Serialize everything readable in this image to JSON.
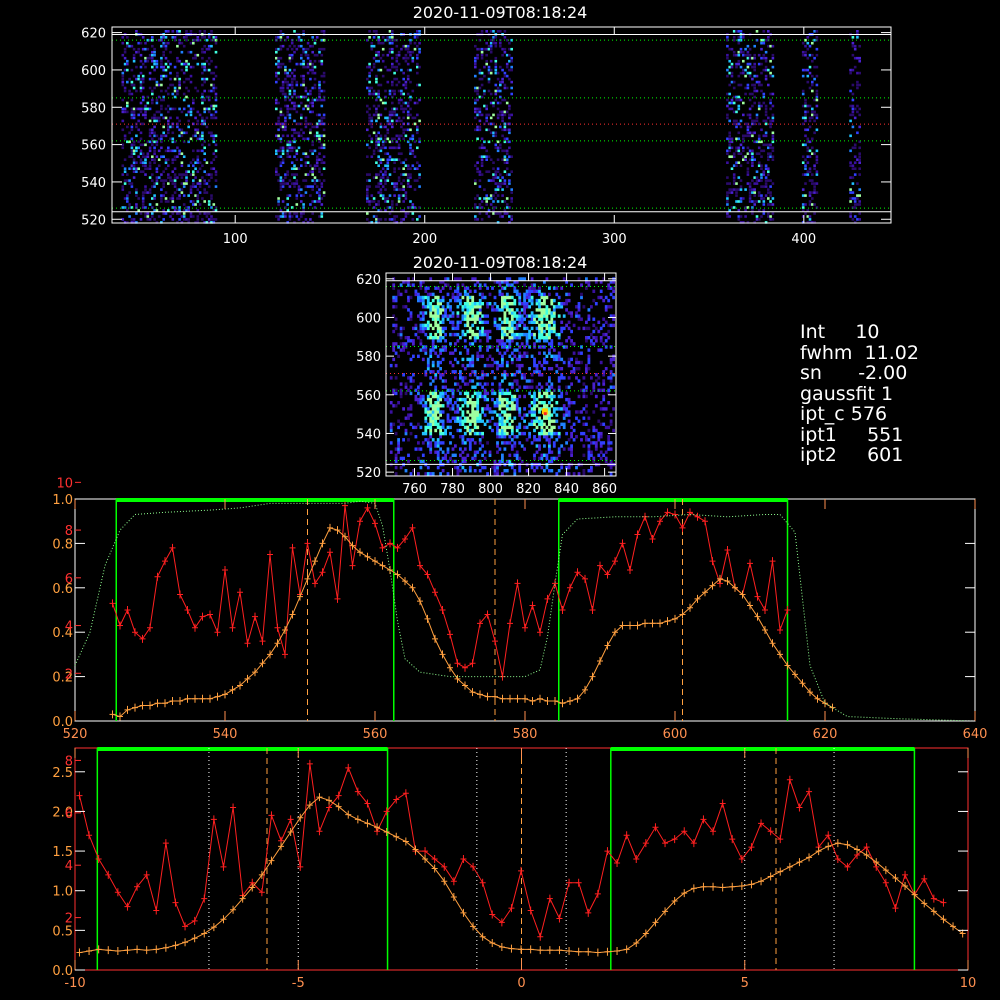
{
  "panels": [
    {
      "id": "top",
      "title": "2020-11-09T08:18:24",
      "xticks": [
        "100",
        "200",
        "300",
        "400"
      ],
      "yticks": [
        "520",
        "540",
        "560",
        "580",
        "600",
        "620"
      ],
      "xrange": [
        35,
        446
      ],
      "yrange": [
        518,
        623
      ],
      "stripes": [
        [
          40,
          90
        ],
        [
          121,
          147
        ],
        [
          169,
          197
        ],
        [
          226,
          246
        ],
        [
          359,
          384
        ],
        [
          399,
          407
        ],
        [
          424,
          429
        ]
      ],
      "hlines": [
        {
          "y": 619,
          "style": "solid",
          "color": "#ffffff"
        },
        {
          "y": 616,
          "style": "dot",
          "color": "#00ff00"
        },
        {
          "y": 585,
          "style": "dot",
          "color": "#00ff00"
        },
        {
          "y": 571,
          "style": "dot",
          "color": "#ff3030"
        },
        {
          "y": 562,
          "style": "dot",
          "color": "#00ff00"
        },
        {
          "y": 526,
          "style": "dot",
          "color": "#00ff00"
        },
        {
          "y": 524,
          "style": "solid",
          "color": "#ffffff"
        }
      ]
    },
    {
      "id": "mid",
      "title": "2020-11-09T08:18:24",
      "xticks": [
        "760",
        "780",
        "800",
        "820",
        "840",
        "860"
      ],
      "yticks": [
        "520",
        "540",
        "560",
        "580",
        "600",
        "620"
      ],
      "xrange": [
        745,
        866
      ],
      "yrange": [
        518,
        623
      ],
      "hlines": [
        {
          "y": 619,
          "style": "solid",
          "color": "#ffffff"
        },
        {
          "y": 616,
          "style": "dot",
          "color": "#00ff00"
        },
        {
          "y": 585,
          "style": "dot",
          "color": "#00ff00"
        },
        {
          "y": 571,
          "style": "dot",
          "color": "#ff3030"
        },
        {
          "y": 562,
          "style": "dot",
          "color": "#00ff00"
        },
        {
          "y": 526,
          "style": "dot",
          "color": "#00ff00"
        },
        {
          "y": 524,
          "style": "solid",
          "color": "#ffffff"
        }
      ]
    }
  ],
  "params": [
    {
      "key": "Int",
      "value": "10"
    },
    {
      "key": "fwhm",
      "value": "11.02"
    },
    {
      "key": "sn",
      "value": "-2.00"
    },
    {
      "key": "gaussfit",
      "value": "1"
    },
    {
      "key": "ipt_c",
      "value": "576"
    },
    {
      "key": "ipt1",
      "value": "551"
    },
    {
      "key": "ipt2",
      "value": "601"
    }
  ],
  "chart_data": [
    {
      "type": "line",
      "xlim": [
        520,
        640
      ],
      "xticks": [
        "520",
        "540",
        "560",
        "580",
        "600",
        "620",
        "640"
      ],
      "yticks_left_white": [
        "0.0",
        "0.2",
        "0.4",
        "0.6",
        "0.8",
        "1.0"
      ],
      "yticks_left_red": [
        "2",
        "4",
        "6",
        "8",
        "10"
      ],
      "green_boxes": [
        [
          525.5,
          562.5
        ],
        [
          584.5,
          615
        ]
      ],
      "vlines": [
        551,
        576,
        601
      ],
      "series": [
        {
          "color": "#ff2020",
          "marker": "+",
          "x_start": 525,
          "x_step": 1,
          "values": [
            0.53,
            0.43,
            0.5,
            0.4,
            0.37,
            0.42,
            0.65,
            0.72,
            0.78,
            0.57,
            0.5,
            0.42,
            0.47,
            0.48,
            0.4,
            0.68,
            0.42,
            0.58,
            0.35,
            0.47,
            0.36,
            0.75,
            0.42,
            0.3,
            0.78,
            0.57,
            0.8,
            0.62,
            0.67,
            0.76,
            0.55,
            0.97,
            0.7,
            0.9,
            0.96,
            0.89,
            0.78,
            0.8,
            0.78,
            0.82,
            0.87,
            0.7,
            0.66,
            0.58,
            0.5,
            0.39,
            0.26,
            0.24,
            0.26,
            0.44,
            0.48,
            0.36,
            0.2,
            0.44,
            0.62,
            0.42,
            0.52,
            0.4,
            0.55,
            0.62,
            0.5,
            0.6,
            0.67,
            0.64,
            0.5,
            0.7,
            0.66,
            0.72,
            0.8,
            0.68,
            0.84,
            0.92,
            0.82,
            0.9,
            0.94,
            0.93,
            0.87,
            0.94,
            0.92,
            0.9,
            0.72,
            0.62,
            0.77,
            0.6,
            0.57,
            0.71,
            0.56,
            0.5,
            0.72,
            0.41,
            0.5
          ]
        },
        {
          "color": "#ffa040",
          "marker": "+",
          "x_start": 525,
          "x_step": 1,
          "values": [
            0.03,
            0.02,
            0.05,
            0.06,
            0.07,
            0.07,
            0.08,
            0.08,
            0.09,
            0.09,
            0.1,
            0.1,
            0.1,
            0.1,
            0.11,
            0.12,
            0.14,
            0.16,
            0.19,
            0.22,
            0.26,
            0.3,
            0.35,
            0.41,
            0.48,
            0.56,
            0.64,
            0.72,
            0.8,
            0.87,
            0.86,
            0.83,
            0.79,
            0.76,
            0.74,
            0.72,
            0.7,
            0.68,
            0.66,
            0.63,
            0.6,
            0.54,
            0.46,
            0.37,
            0.3,
            0.24,
            0.19,
            0.16,
            0.13,
            0.12,
            0.11,
            0.11,
            0.1,
            0.1,
            0.1,
            0.1,
            0.09,
            0.1,
            0.09,
            0.09,
            0.08,
            0.09,
            0.1,
            0.14,
            0.2,
            0.27,
            0.34,
            0.4,
            0.43,
            0.43,
            0.43,
            0.44,
            0.44,
            0.44,
            0.45,
            0.46,
            0.48,
            0.51,
            0.55,
            0.58,
            0.61,
            0.64,
            0.63,
            0.6,
            0.57,
            0.52,
            0.47,
            0.41,
            0.35,
            0.3,
            0.25,
            0.21,
            0.17,
            0.13,
            0.1,
            0.08,
            0.06
          ]
        },
        {
          "color": "#90ff90",
          "style": "dot",
          "points": [
            [
              520,
              0.25
            ],
            [
              522,
              0.4
            ],
            [
              524,
              0.7
            ],
            [
              526,
              0.86
            ],
            [
              528,
              0.93
            ],
            [
              532,
              0.94
            ],
            [
              538,
              0.95
            ],
            [
              542,
              0.96
            ],
            [
              546,
              0.98
            ],
            [
              552,
              0.98
            ],
            [
              556,
              0.98
            ],
            [
              558,
              0.99
            ],
            [
              560,
              0.98
            ],
            [
              561,
              0.88
            ],
            [
              562,
              0.68
            ],
            [
              563,
              0.45
            ],
            [
              564,
              0.28
            ],
            [
              566,
              0.22
            ],
            [
              570,
              0.2
            ],
            [
              575,
              0.2
            ],
            [
              580,
              0.2
            ],
            [
              582,
              0.23
            ],
            [
              583,
              0.38
            ],
            [
              584,
              0.62
            ],
            [
              585,
              0.84
            ],
            [
              587,
              0.91
            ],
            [
              592,
              0.92
            ],
            [
              597,
              0.92
            ],
            [
              602,
              0.93
            ],
            [
              607,
              0.92
            ],
            [
              612,
              0.93
            ],
            [
              614,
              0.93
            ],
            [
              616,
              0.85
            ],
            [
              617,
              0.55
            ],
            [
              618,
              0.25
            ],
            [
              620,
              0.08
            ],
            [
              623,
              0.02
            ],
            [
              630,
              0.01
            ],
            [
              640,
              0.0
            ]
          ]
        }
      ]
    },
    {
      "type": "line",
      "xlim": [
        -10,
        10
      ],
      "xticks": [
        "-10",
        "-5",
        "0",
        "5",
        "10"
      ],
      "yticks_left_white": [
        "0.0",
        "0.5",
        "1.0",
        "1.5",
        "2.0",
        "2.5"
      ],
      "yticks_left_red": [
        "2",
        "4",
        "6",
        "8"
      ],
      "green_boxes": [
        [
          -9.5,
          -3
        ],
        [
          2,
          8.8
        ]
      ],
      "vlines": [
        -5.7,
        0,
        5.7
      ],
      "dotted_vlines": [
        -7,
        -5,
        -1,
        1,
        5,
        7
      ],
      "series": [
        {
          "color": "#ff2020",
          "marker": "+",
          "x_start": -9.9,
          "x_step": 0.215,
          "values": [
            2.2,
            1.7,
            1.4,
            1.2,
            0.98,
            0.8,
            1.05,
            1.2,
            0.75,
            1.6,
            0.85,
            0.55,
            0.62,
            0.9,
            1.9,
            1.3,
            2.05,
            0.94,
            1.1,
            0.98,
            1.95,
            1.63,
            1.9,
            1.3,
            2.6,
            1.75,
            2.05,
            2.2,
            2.55,
            2.25,
            2.1,
            1.75,
            2.0,
            2.15,
            2.23,
            1.5,
            1.5,
            1.4,
            1.3,
            1.12,
            1.4,
            1.3,
            1.1,
            0.7,
            0.6,
            0.78,
            1.25,
            0.75,
            0.42,
            0.9,
            0.65,
            1.1,
            1.1,
            0.72,
            0.96,
            1.5,
            1.35,
            1.7,
            1.4,
            1.6,
            1.8,
            1.6,
            1.65,
            1.75,
            1.6,
            1.9,
            1.75,
            2.1,
            1.65,
            1.4,
            1.55,
            1.85,
            1.75,
            1.65,
            2.4,
            2.05,
            2.25,
            1.55,
            1.7,
            1.4,
            1.3,
            1.45,
            1.55,
            1.3,
            1.1,
            0.78,
            1.2,
            0.95,
            1.15,
            0.9,
            0.85
          ]
        },
        {
          "color": "#ffa040",
          "marker": "+",
          "x_start": -9.9,
          "x_step": 0.215,
          "values": [
            0.22,
            0.24,
            0.26,
            0.25,
            0.24,
            0.25,
            0.26,
            0.25,
            0.26,
            0.28,
            0.31,
            0.35,
            0.4,
            0.46,
            0.54,
            0.64,
            0.76,
            0.9,
            1.04,
            1.2,
            1.38,
            1.56,
            1.74,
            1.92,
            2.08,
            2.18,
            2.14,
            2.06,
            1.96,
            1.9,
            1.85,
            1.8,
            1.74,
            1.68,
            1.62,
            1.52,
            1.4,
            1.28,
            1.12,
            0.92,
            0.72,
            0.55,
            0.42,
            0.34,
            0.29,
            0.27,
            0.26,
            0.26,
            0.25,
            0.25,
            0.25,
            0.24,
            0.23,
            0.23,
            0.22,
            0.23,
            0.24,
            0.26,
            0.34,
            0.46,
            0.6,
            0.74,
            0.87,
            0.97,
            1.03,
            1.05,
            1.05,
            1.04,
            1.05,
            1.06,
            1.08,
            1.12,
            1.18,
            1.24,
            1.3,
            1.36,
            1.42,
            1.5,
            1.56,
            1.6,
            1.58,
            1.52,
            1.45,
            1.36,
            1.26,
            1.16,
            1.06,
            0.95,
            0.84,
            0.74,
            0.64,
            0.55,
            0.46,
            0.37,
            0.28,
            0.2,
            0.14,
            0.11
          ]
        }
      ]
    }
  ]
}
